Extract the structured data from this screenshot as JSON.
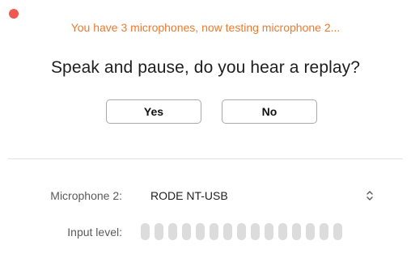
{
  "window": {
    "close_color": "#ee5a52"
  },
  "status": {
    "text": "You have 3 microphones, now testing microphone 2...",
    "color": "#ec7a2e"
  },
  "prompt": {
    "question": "Speak and pause, do you hear a replay?"
  },
  "buttons": {
    "yes_label": "Yes",
    "no_label": "No"
  },
  "settings": {
    "microphone_label": "Microphone 2:",
    "microphone_value": "RODE NT-USB",
    "chevron_icon": "updown-chevron-icon",
    "input_level_label": "Input level:",
    "input_level_segments": 15,
    "input_level_active": 0
  }
}
